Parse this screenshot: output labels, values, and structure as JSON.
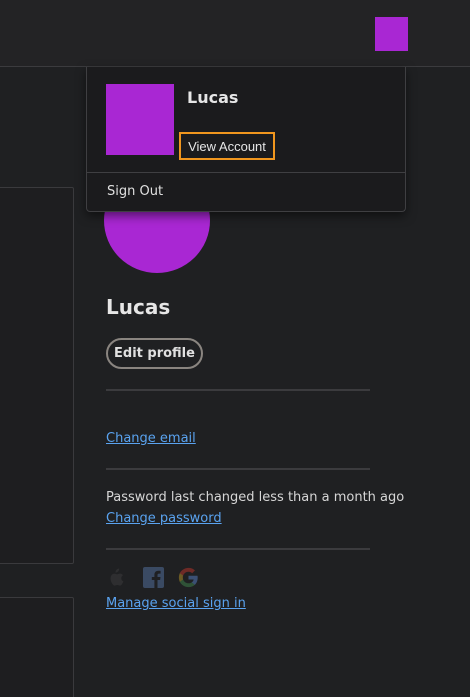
{
  "user": {
    "name": "Lucas",
    "avatar_color": "#a927d3"
  },
  "dropdown": {
    "name": "Lucas",
    "view_account_label": "View Account",
    "sign_out_label": "Sign Out"
  },
  "profile": {
    "name": "Lucas",
    "edit_profile_label": "Edit profile",
    "change_email_label": "Change email",
    "password_status": "Password last changed less than a month ago",
    "change_password_label": "Change password",
    "manage_social_label": "Manage social sign in",
    "social_icons": [
      "apple-icon",
      "facebook-icon",
      "google-icon"
    ]
  },
  "colors": {
    "accent_link": "#5aa3f0",
    "focus_ring": "#f0961e",
    "background": "#1f2022"
  }
}
